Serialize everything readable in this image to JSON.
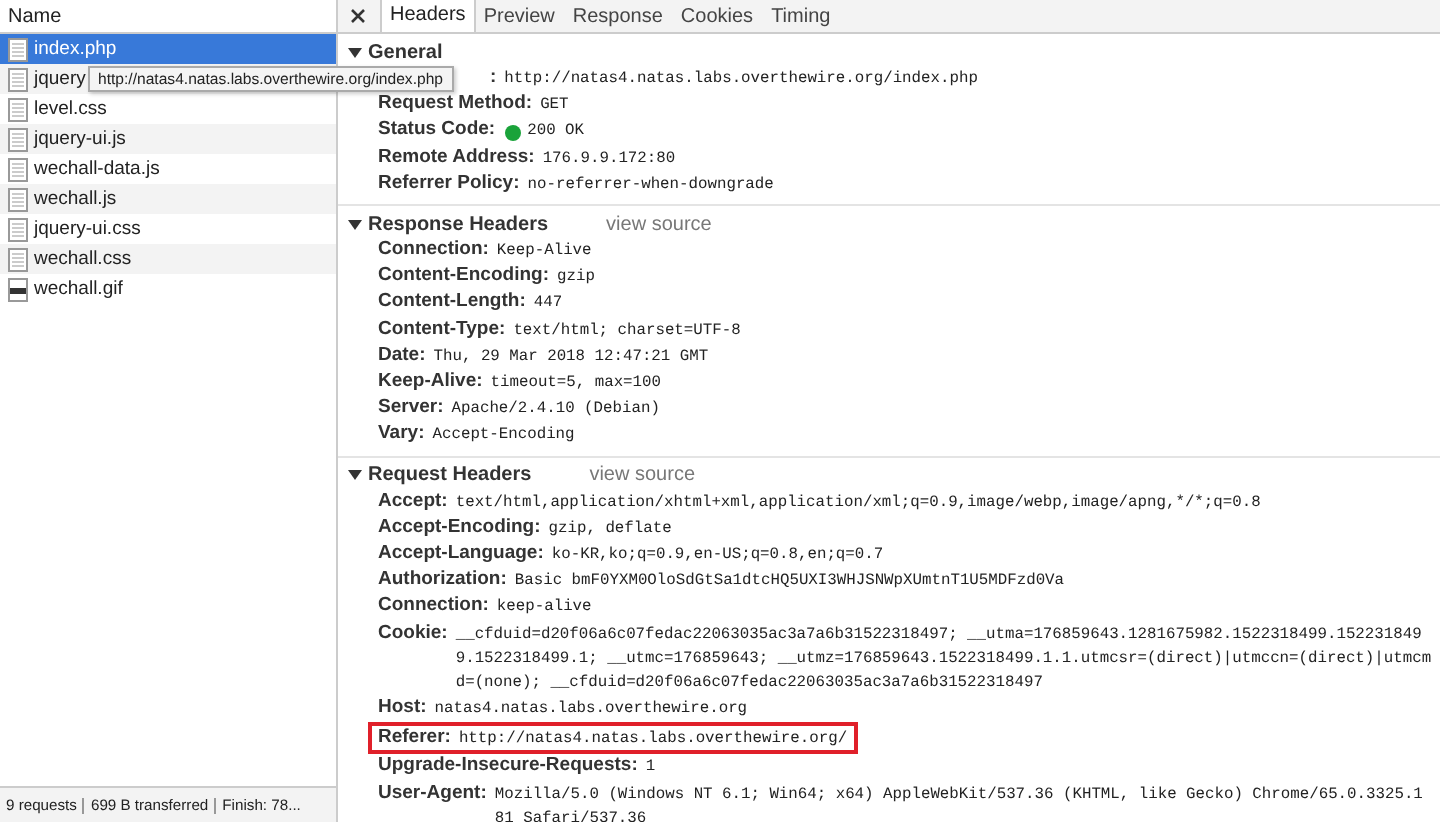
{
  "sidebar": {
    "header": "Name",
    "items": [
      {
        "name": "index.php",
        "kind": "doc",
        "selected": true
      },
      {
        "name": "jquery",
        "kind": "doc",
        "selected": false
      },
      {
        "name": "level.css",
        "kind": "doc",
        "selected": false
      },
      {
        "name": "jquery-ui.js",
        "kind": "doc",
        "selected": false
      },
      {
        "name": "wechall-data.js",
        "kind": "doc",
        "selected": false
      },
      {
        "name": "wechall.js",
        "kind": "doc",
        "selected": false
      },
      {
        "name": "jquery-ui.css",
        "kind": "doc",
        "selected": false
      },
      {
        "name": "wechall.css",
        "kind": "doc",
        "selected": false
      },
      {
        "name": "wechall.gif",
        "kind": "image",
        "selected": false
      }
    ],
    "tooltip": "http://natas4.natas.labs.overthewire.org/index.php",
    "status_bar": [
      "9 requests",
      "699 B transferred",
      "Finish: 78..."
    ]
  },
  "tabs": [
    {
      "label": "Headers",
      "selected": true
    },
    {
      "label": "Preview",
      "selected": false
    },
    {
      "label": "Response",
      "selected": false
    },
    {
      "label": "Cookies",
      "selected": false
    },
    {
      "label": "Timing",
      "selected": false
    }
  ],
  "sections": [
    {
      "title": "General",
      "rows": [
        {
          "key": ":",
          "value": "http://natas4.natas.labs.overthewire.org/index.php",
          "kind": "covered"
        },
        {
          "key": "Request Method:",
          "value": "GET"
        },
        {
          "key": "Status Code:",
          "value": "200 OK",
          "kind": "status"
        },
        {
          "key": "Remote Address:",
          "value": "176.9.9.172:80"
        },
        {
          "key": "Referrer Policy:",
          "value": "no-referrer-when-downgrade"
        }
      ]
    },
    {
      "title": "Response Headers",
      "link": "view source",
      "rows": [
        {
          "key": "Connection:",
          "value": "Keep-Alive"
        },
        {
          "key": "Content-Encoding:",
          "value": "gzip"
        },
        {
          "key": "Content-Length:",
          "value": "447"
        },
        {
          "key": "Content-Type:",
          "value": "text/html; charset=UTF-8"
        },
        {
          "key": "Date:",
          "value": "Thu, 29 Mar 2018 12:47:21 GMT"
        },
        {
          "key": "Keep-Alive:",
          "value": "timeout=5, max=100"
        },
        {
          "key": "Server:",
          "value": "Apache/2.4.10 (Debian)"
        },
        {
          "key": "Vary:",
          "value": "Accept-Encoding"
        }
      ]
    },
    {
      "title": "Request Headers",
      "link": "view source",
      "rows": [
        {
          "key": "Accept:",
          "value": "text/html,application/xhtml+xml,application/xml;q=0.9,image/webp,image/apng,*/*;q=0.8"
        },
        {
          "key": "Accept-Encoding:",
          "value": "gzip, deflate"
        },
        {
          "key": "Accept-Language:",
          "value": "ko-KR,ko;q=0.9,en-US;q=0.8,en;q=0.7"
        },
        {
          "key": "Authorization:",
          "value": "Basic bmF0YXM0OloSdGtSa1dtcHQ5UXI3WHJSNWpXUmtnT1U5MDFzd0Va"
        },
        {
          "key": "Connection:",
          "value": "keep-alive"
        },
        {
          "key": "Cookie:",
          "value": "__cfduid=d20f06a6c07fedac22063035ac3a7a6b31522318497; __utma=176859643.1281675982.1522318499.1522318499.1522318499.1; __utmc=176859643; __utmz=176859643.1522318499.1.1.utmcsr=(direct)|utmccn=(direct)|utmcmd=(none); __cfduid=d20f06a6c07fedac22063035ac3a7a6b31522318497"
        },
        {
          "key": "Host:",
          "value": "natas4.natas.labs.overthewire.org"
        },
        {
          "key": "Referer:",
          "value": "http://natas4.natas.labs.overthewire.org/",
          "highlighted": true
        },
        {
          "key": "Upgrade-Insecure-Requests:",
          "value": "1"
        },
        {
          "key": "User-Agent:",
          "value": "Mozilla/5.0 (Windows NT 6.1; Win64; x64) AppleWebKit/537.36 (KHTML, like Gecko) Chrome/65.0.3325.181 Safari/537.36"
        }
      ]
    }
  ]
}
